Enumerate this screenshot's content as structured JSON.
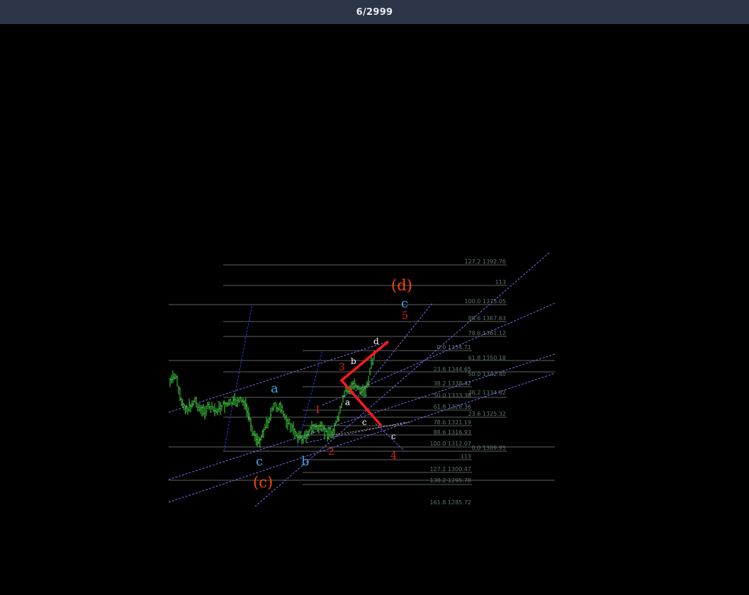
{
  "header": {
    "counter": "6/2999"
  },
  "chart": {
    "fib_levels": [
      "127.2 1392.76",
      "113",
      "100.0 1373.05",
      "88.6 1367.63",
      "78.6 1361.12",
      "0.0 1354.71",
      "61.8 1350.18",
      "23.6 1344.65",
      "50.0 1342.40",
      "38.2 1338.42",
      "38.2 1334.82",
      "50.0 1333.38",
      "61.8 1328.36",
      "23.6 1325.32",
      "78.6 1321.19",
      "88.6 1316.93",
      "100.0 1312.07",
      "0.0 1309.95",
      "113",
      "127.2 1300.47",
      "138.2 1295.78",
      "161.8 1285.72"
    ],
    "wave_labels": {
      "d_paren": "(d)",
      "c_paren": "(c)",
      "c_top": "c",
      "a_blue": "a",
      "c_blue": "c",
      "b_blue": "b",
      "w5": "5",
      "w3": "3",
      "w1": "1",
      "w2": "2",
      "w4": "4",
      "d_white": "d",
      "b_white": "b",
      "a_white": "a",
      "c_white": "c",
      "c_white2": "c"
    },
    "colors": {
      "bars": "#3fd43f",
      "impulse": "#ff1a1a",
      "channel": "#7a6cf0",
      "trend": "#3040ff",
      "fib_line": "#5b6360",
      "label_blue": "#3aa3e8",
      "label_red": "#e02020",
      "label_orange": "#ff4500"
    }
  }
}
